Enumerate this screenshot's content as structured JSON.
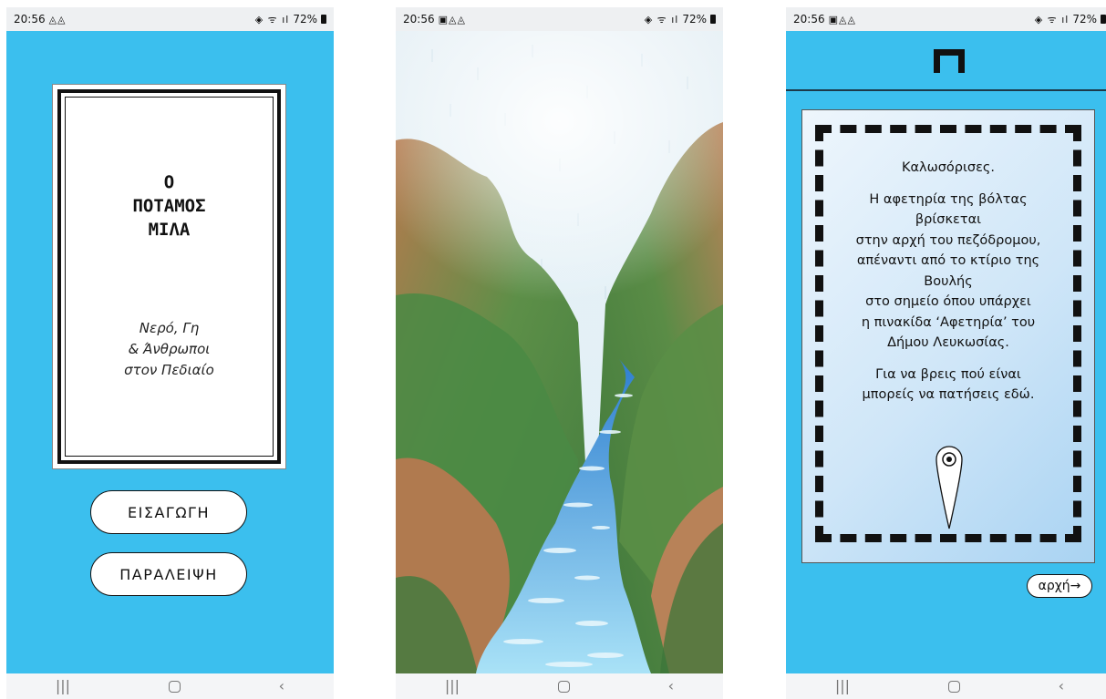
{
  "status_bars": [
    {
      "time": "20:56",
      "icons": "◬◬",
      "signal": "72%"
    },
    {
      "time": "20:56",
      "icons": "▣◬◬",
      "signal": "72%"
    },
    {
      "time": "20:56",
      "icons": "▣◬◬",
      "signal": "72%"
    }
  ],
  "nav": {
    "recent": "|||",
    "back": "‹"
  },
  "screen1": {
    "title_line1": "Ο",
    "title_line2": "ΠΟΤΑΜΟΣ",
    "title_line3": "ΜΙΛΑ",
    "subtitle_line1": "Νερό, Γη",
    "subtitle_line2": "& Άνθρωποι",
    "subtitle_line3": "στον Πεδιαίο",
    "intro_button": "ΕΙΣΑΓΩΓΗ",
    "skip_button": "ΠΑΡΑΛΕΙΨΗ"
  },
  "screen3": {
    "p1": "Καλωσόρισες.",
    "p2_l1": "Η αφετηρία της βόλτας",
    "p2_l2": "βρίσκεται",
    "p2_l3": "στην αρχή του πεζόδρομου,",
    "p2_l4": "απέναντι από το κτίριο της",
    "p2_l5": "Βουλής",
    "p2_l6": "στο σημείο όπου υπάρχει",
    "p2_l7": "η πινακίδα ‘Αφετηρία’ του",
    "p2_l8": "Δήμου Λευκωσίας.",
    "p3_l1": "Για να βρεις πού είναι",
    "p3_l2": "μπορείς να πατήσεις εδώ.",
    "next_button": "αρχή→"
  },
  "colors": {
    "screen_bg": "#3bbfee",
    "river": "#8fd4f2",
    "mountain_green": "#4d8b45",
    "mountain_brown": "#b07a4f"
  }
}
